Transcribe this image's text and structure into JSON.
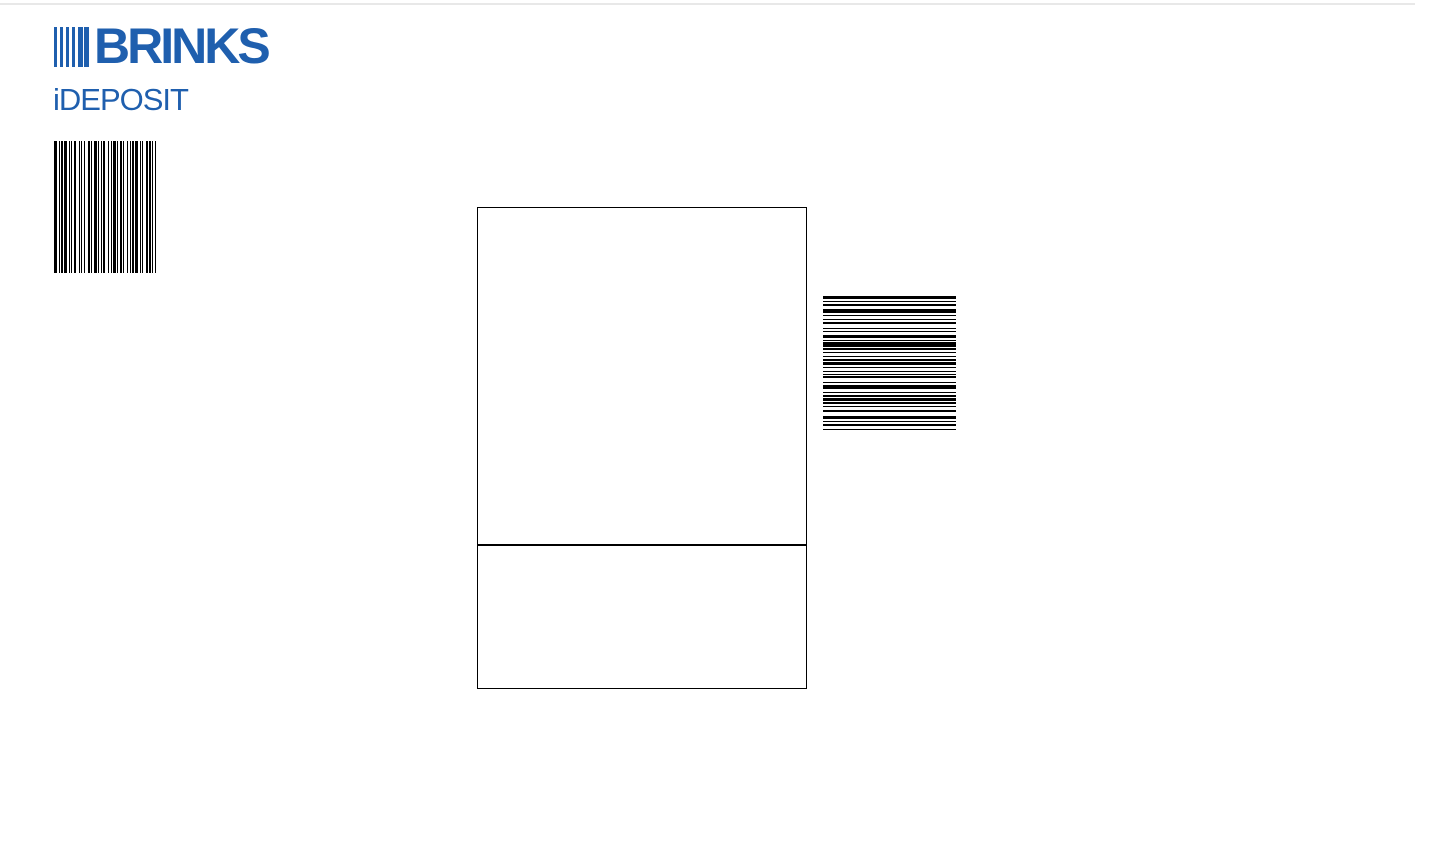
{
  "header": {
    "brand_name": "BRINKS",
    "product_name": "iDEPOSIT"
  },
  "colors": {
    "brand_blue": "#1f5fae",
    "barcode_black": "#000000"
  },
  "icons": {
    "logo_mark": "barcode-stripes-logo-icon"
  }
}
